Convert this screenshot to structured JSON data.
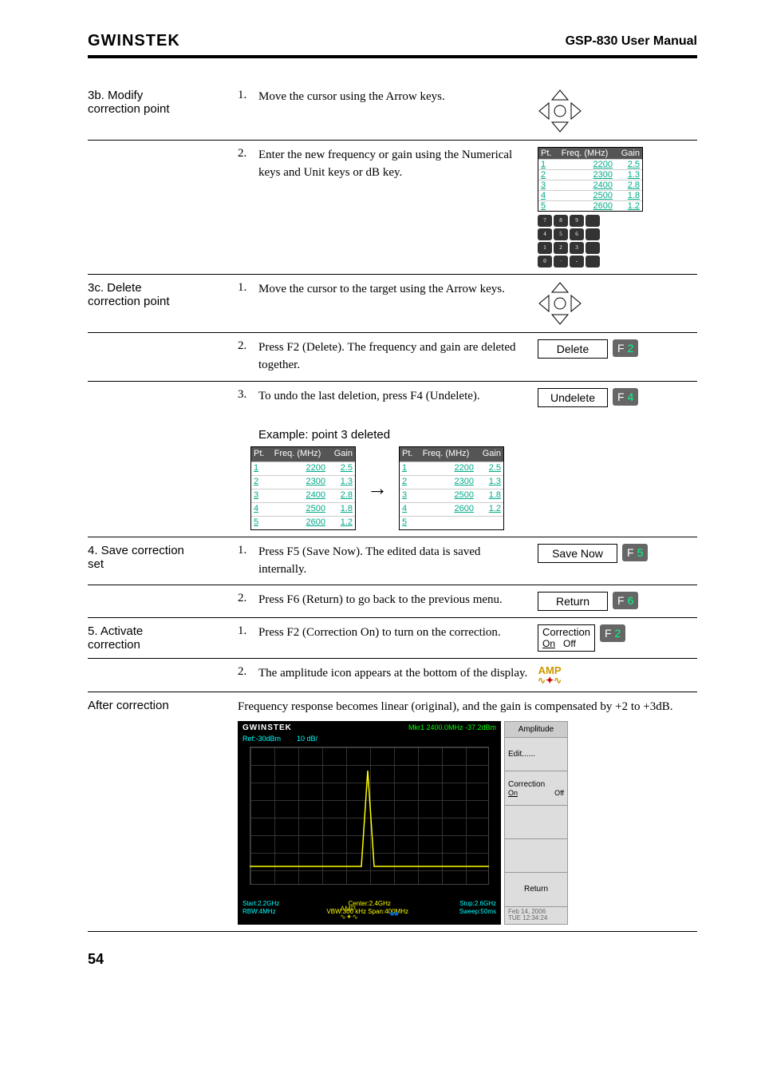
{
  "header": {
    "brand": "GWINSTEK",
    "title": "GSP-830 User Manual"
  },
  "sec3b": {
    "heading": "3b. Modify\ncorrection point",
    "step1_num": "1.",
    "step1": "Move the cursor using the Arrow keys.",
    "step2_num": "2.",
    "step2": "Enter the new frequency or gain using the Numerical keys and Unit keys or dB key.",
    "table_head": {
      "pt": "Pt.",
      "freq": "Freq. (MHz)",
      "gain": "Gain"
    },
    "table_rows": [
      {
        "pt": "1",
        "freq": "2200",
        "gain": "2.5"
      },
      {
        "pt": "2",
        "freq": "2300",
        "gain": "1.3"
      },
      {
        "pt": "3",
        "freq": "2400",
        "gain": "2.8"
      },
      {
        "pt": "4",
        "freq": "2500",
        "gain": "1.8"
      },
      {
        "pt": "5",
        "freq": "2600",
        "gain": "1.2"
      }
    ]
  },
  "sec3c": {
    "heading": "3c. Delete\ncorrection point",
    "step1_num": "1.",
    "step1": "Move the cursor to the target using the Arrow keys.",
    "step2_num": "2.",
    "step2": "Press F2 (Delete). The frequency and gain are deleted together.",
    "delete_label": "Delete",
    "f2_label": "F",
    "f2_num": "2",
    "step3_num": "3.",
    "step3": "To undo the last deletion, press F4 (Undelete).",
    "undelete_label": "Undelete",
    "f4_label": "F",
    "f4_num": "4",
    "example_title": "Example: point 3 deleted",
    "table_before": [
      {
        "pt": "1",
        "freq": "2200",
        "gain": "2.5"
      },
      {
        "pt": "2",
        "freq": "2300",
        "gain": "1.3"
      },
      {
        "pt": "3",
        "freq": "2400",
        "gain": "2.8"
      },
      {
        "pt": "4",
        "freq": "2500",
        "gain": "1.8"
      },
      {
        "pt": "5",
        "freq": "2600",
        "gain": "1.2"
      }
    ],
    "table_after": [
      {
        "pt": "1",
        "freq": "2200",
        "gain": "2.5"
      },
      {
        "pt": "2",
        "freq": "2300",
        "gain": "1.3"
      },
      {
        "pt": "3",
        "freq": "2500",
        "gain": "1.8"
      },
      {
        "pt": "4",
        "freq": "2600",
        "gain": "1.2"
      },
      {
        "pt": "5",
        "freq": "",
        "gain": ""
      }
    ]
  },
  "sec4": {
    "heading": "4. Save correction\nset",
    "step1_num": "1.",
    "step1": "Press F5 (Save Now). The edited data is saved internally.",
    "save_label": "Save Now",
    "f5_label": "F",
    "f5_num": "5",
    "step2_num": "2.",
    "step2": "Press F6 (Return) to go back to the previous menu.",
    "return_label": "Return",
    "f6_label": "F",
    "f6_num": "6"
  },
  "sec5": {
    "heading": "5. Activate\ncorrection",
    "step1_num": "1.",
    "step1": "Press F2 (Correction On) to turn on the correction.",
    "corr_label": "Correction",
    "on": "On",
    "off": "Off",
    "f2_label": "F",
    "f2_num": "2",
    "step2_num": "2.",
    "step2": "The amplitude icon appears at the bottom of the display.",
    "amp_text": "AMP"
  },
  "after": {
    "heading": "After correction",
    "text": "Frequency response becomes linear (original), and the gain is compensated by +2 to +3dB.",
    "scope": {
      "brand": "GWINSTEK",
      "mkr": "Mkr1 2400.0MHz  -37.2dBm",
      "ref": "Ref:-30dBm",
      "div": "10 dB/",
      "start": "Start:2.2GHz",
      "center": "Center:2.4GHz",
      "stop": "Stop:2.6GHz",
      "rbw": "RBW:4MHz",
      "vbw": "VBW:300 kHz",
      "span": "Span:400MHz",
      "sweep": "Sweep:50ms",
      "date1": "Feb 14, 2006",
      "date2": "TUE 12:34:24"
    },
    "menu": {
      "head": "Amplitude",
      "edit": "Edit......",
      "correction": "Correction",
      "on": "On",
      "off": "Off",
      "return": "Return"
    }
  },
  "page_num": "54"
}
